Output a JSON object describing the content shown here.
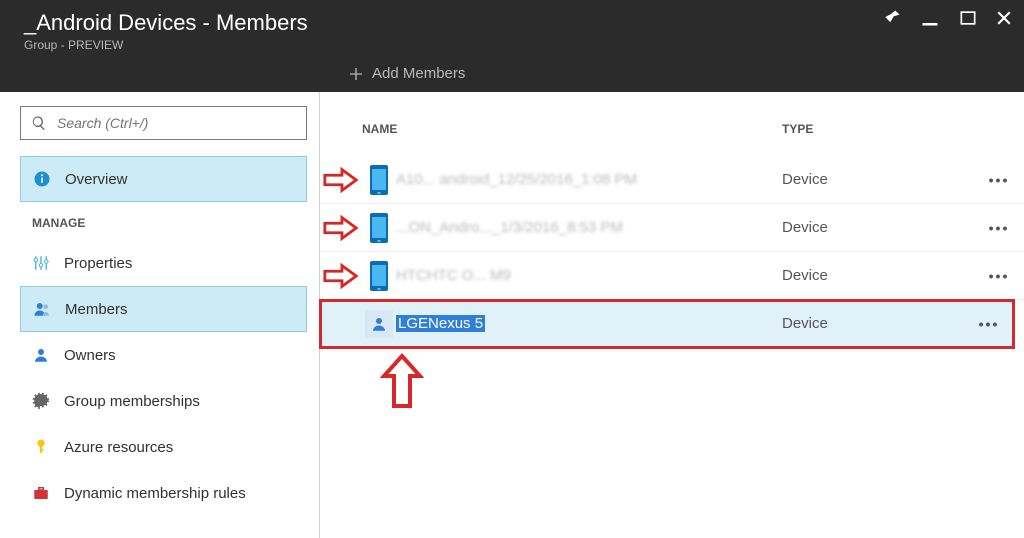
{
  "header": {
    "title": "_Android Devices - Members",
    "subtitle": "Group - PREVIEW"
  },
  "toolbar": {
    "addMembers": "Add Members"
  },
  "search": {
    "placeholder": "Search (Ctrl+/)"
  },
  "sidebar": {
    "overview": "Overview",
    "manageLabel": "MANAGE",
    "items": {
      "properties": "Properties",
      "members": "Members",
      "owners": "Owners",
      "groupMemberships": "Group memberships",
      "azureResources": "Azure resources",
      "dynamicRules": "Dynamic membership rules"
    }
  },
  "table": {
    "headers": {
      "name": "NAME",
      "type": "TYPE"
    },
    "rows": [
      {
        "name": "A10...  android_12/25/2016_1:08 PM",
        "type": "Device",
        "blurred": true
      },
      {
        "name": "...ON_Andro..._1/3/2016_8:53 PM",
        "type": "Device",
        "blurred": true
      },
      {
        "name": "HTCHTC O... M9",
        "type": "Device",
        "blurred": true
      },
      {
        "name": "LGENexus 5",
        "type": "Device",
        "highlighted": true
      }
    ]
  }
}
